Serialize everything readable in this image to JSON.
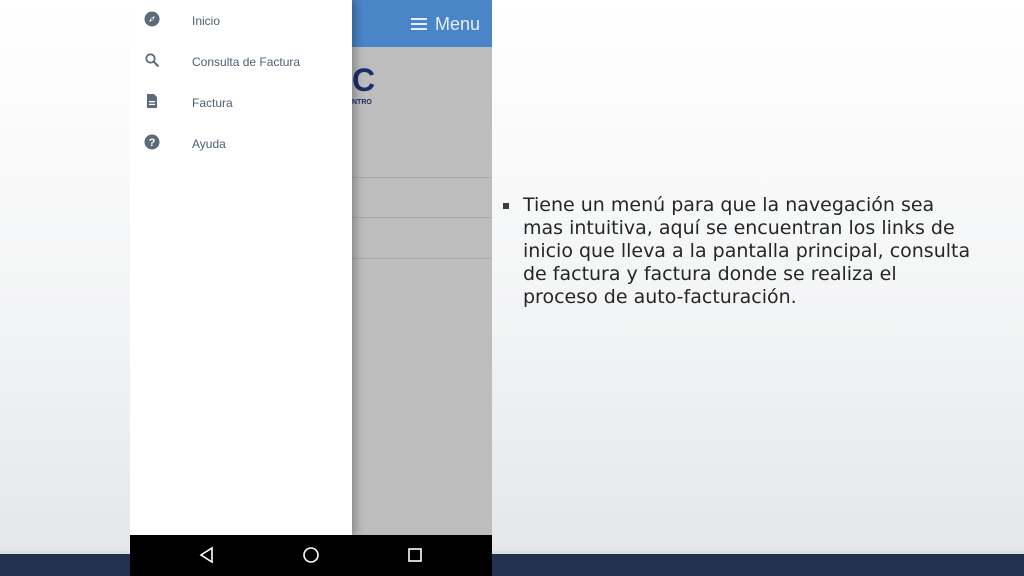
{
  "app_bar": {
    "menu_label": "Menu",
    "menu_icon": "hamburger-icon"
  },
  "logo": {
    "letter": "C",
    "sub": "NTRO"
  },
  "drawer": {
    "items": [
      {
        "label": "Inicio",
        "icon": "compass-icon"
      },
      {
        "label": "Consulta de Factura",
        "icon": "search-icon"
      },
      {
        "label": "Factura",
        "icon": "document-icon"
      },
      {
        "label": "Ayuda",
        "icon": "help-icon"
      }
    ]
  },
  "nav_bar": {
    "buttons": [
      "back-icon",
      "home-icon",
      "recents-icon"
    ]
  },
  "slide": {
    "bullet_text": "Tiene un menú para que la navegación sea mas intuitiva, aquí se encuentran los links de inicio que lleva a la pantalla principal, consulta de factura y factura donde se realiza el proceso de auto-facturación."
  },
  "colors": {
    "app_bar": "#4a86c7",
    "background_dim": "#bdbdbd",
    "drawer_text": "#4f5f6f",
    "icon": "#5b6b7a",
    "bottom_band": "#23304f"
  }
}
